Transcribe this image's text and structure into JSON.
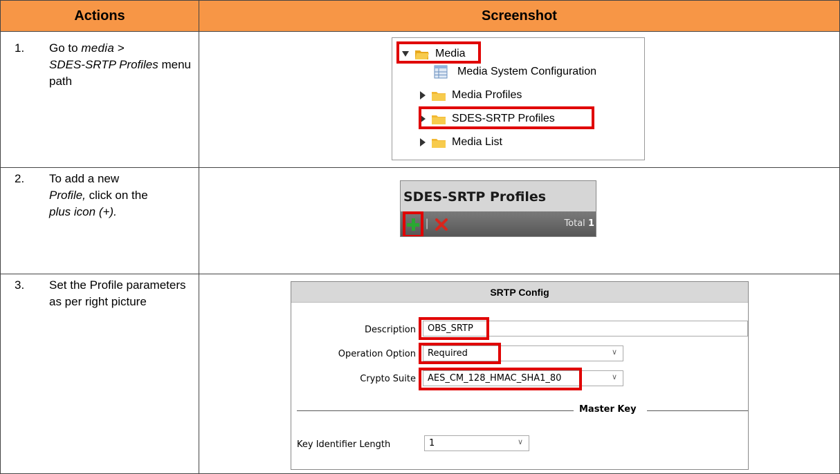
{
  "header": {
    "actions": "Actions",
    "screenshot": "Screenshot"
  },
  "steps": [
    {
      "num": "1.",
      "prefix": "Go to ",
      "path1": "media",
      "sep": " > ",
      "path2": "SDES-SRTP Profiles",
      "suffix": " menu path"
    },
    {
      "num": "2.",
      "prefix": "To add a new ",
      "obj": "Profile,",
      "mid": " click on the ",
      "icon": "plus icon (+)."
    },
    {
      "num": "3.",
      "text": "Set the Profile parameters as per right picture"
    }
  ],
  "tree": {
    "items": [
      {
        "label": "Media",
        "icon": "folder-open-icon",
        "expander": "expanded"
      },
      {
        "label": "Media System Configuration",
        "icon": "table-config-icon"
      },
      {
        "label": "Media Profiles",
        "icon": "folder-icon",
        "expander": "collapsed"
      },
      {
        "label": "SDES-SRTP Profiles",
        "icon": "folder-icon",
        "expander": "collapsed"
      },
      {
        "label": "Media List",
        "icon": "folder-icon",
        "expander": "collapsed"
      }
    ]
  },
  "profiles_panel": {
    "title": "SDES-SRTP Profiles",
    "separator": "|",
    "total_label": "Total",
    "total_value": "1",
    "add_icon": "plus-icon",
    "delete_icon": "x-icon"
  },
  "srtp_form": {
    "title": "SRTP Config",
    "description_label": "Description",
    "description_value": "OBS_SRTP",
    "operation_label": "Operation Option",
    "operation_value": "Required",
    "crypto_label": "Crypto Suite",
    "crypto_value": "AES_CM_128_HMAC_SHA1_80",
    "master_key_legend": "Master Key",
    "key_id_label": "Key Identifier Length",
    "key_id_value": "1"
  },
  "colors": {
    "header": "#f79646",
    "highlight": "#e00000",
    "plus": "#2aa832",
    "delete": "#d9261c"
  }
}
